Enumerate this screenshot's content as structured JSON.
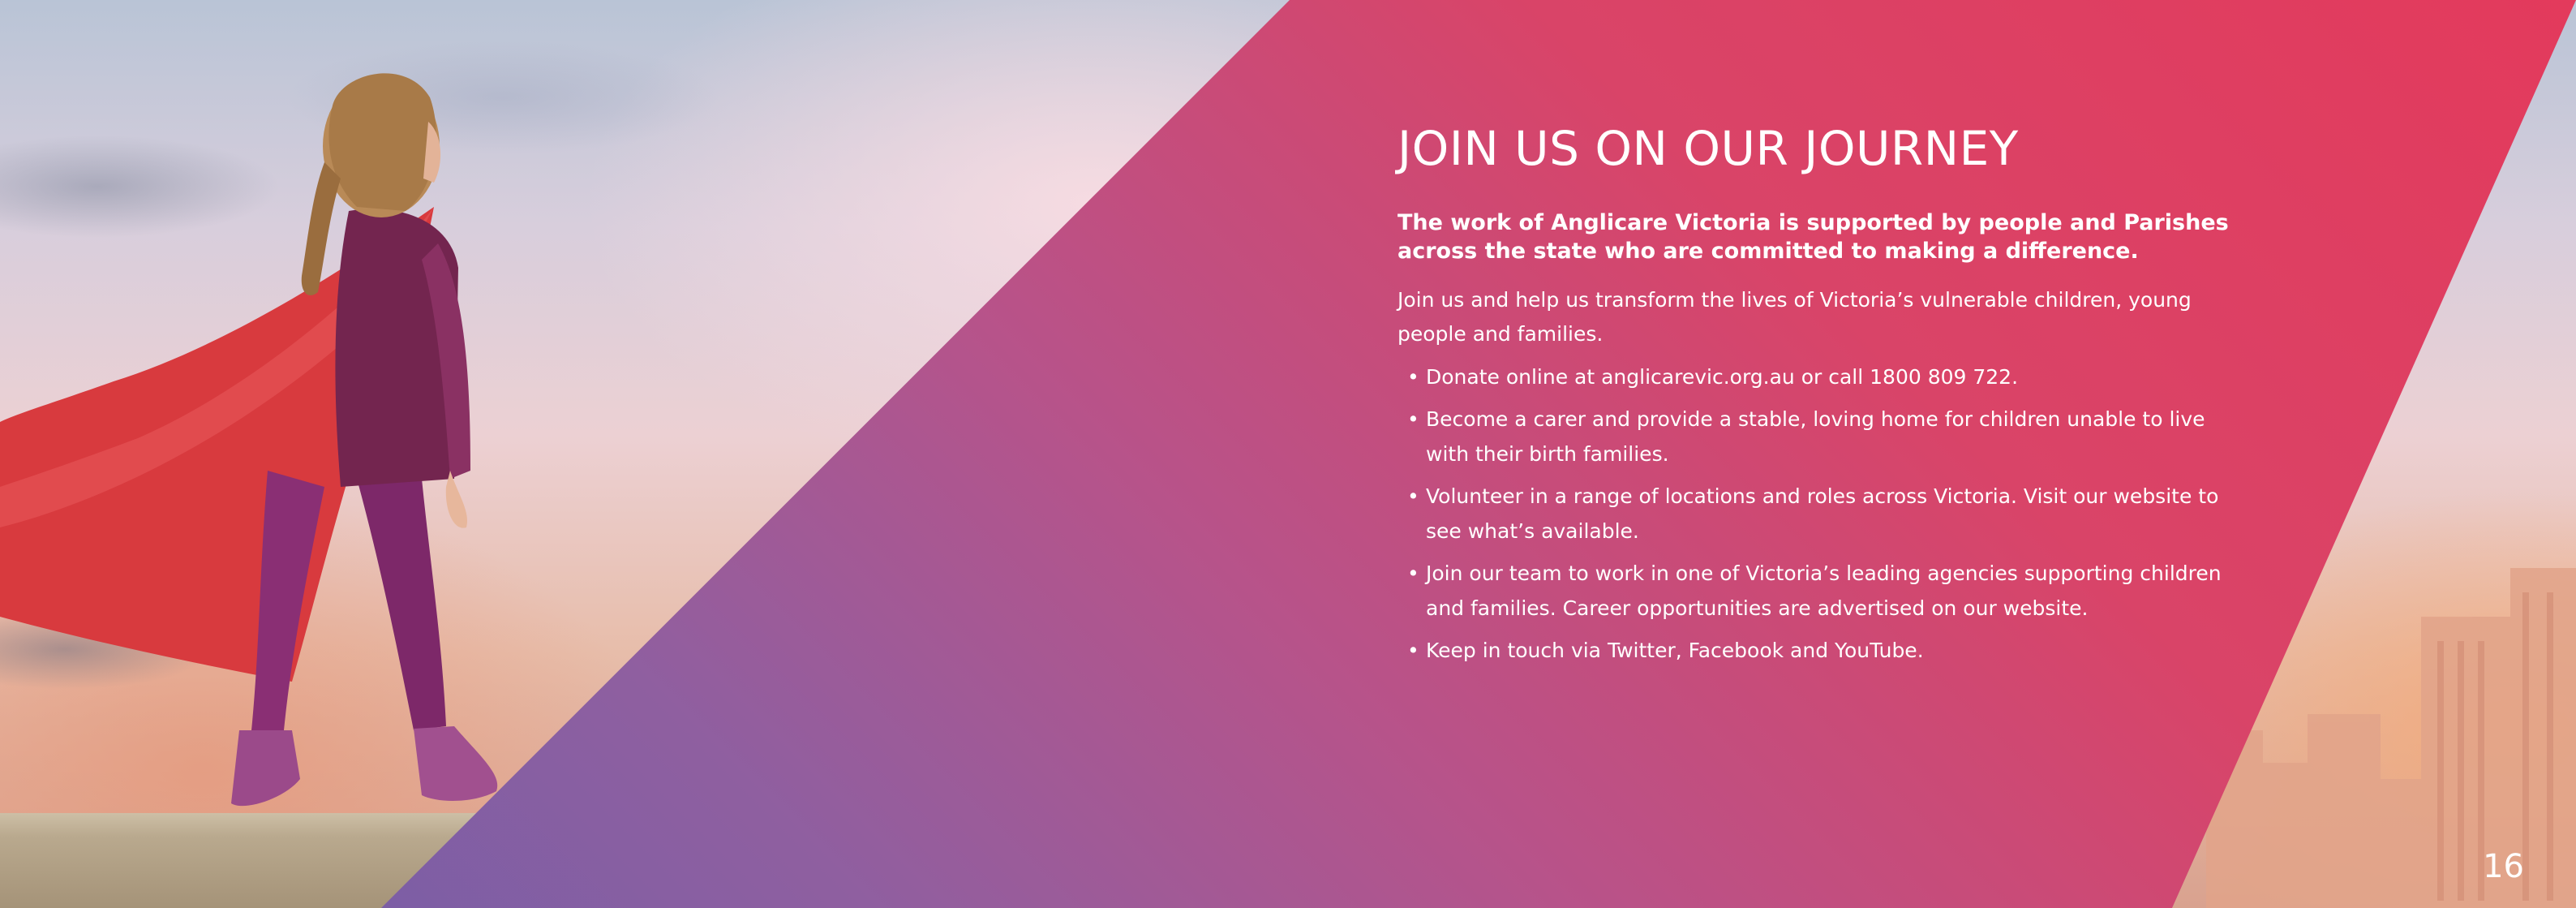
{
  "page": {
    "heading": "JOIN US ON OUR JOURNEY",
    "intro": "The work of Anglicare Victoria is supported by people and Parishes across the state who are committed to making a difference.",
    "paragraph": "Join us and help us transform the lives of Victoria’s vulnerable children, young people and families.",
    "bullets": [
      "Donate online at anglicarevic.org.au or call 1800 809 722.",
      "Become a carer and provide a stable, loving home for children unable to live with their birth families.",
      "Volunteer in a range of locations and roles across Victoria. Visit our website to see what’s available.",
      "Join our team to work in one of Victoria’s leading agencies supporting children and families. Career opportunities are advertised on our website.",
      "Keep in touch via Twitter, Facebook and YouTube."
    ],
    "page_number": "16"
  },
  "colors": {
    "band_top": "#e33a5c",
    "band_bottom": "#6e5ea9",
    "text": "#ffffff"
  }
}
